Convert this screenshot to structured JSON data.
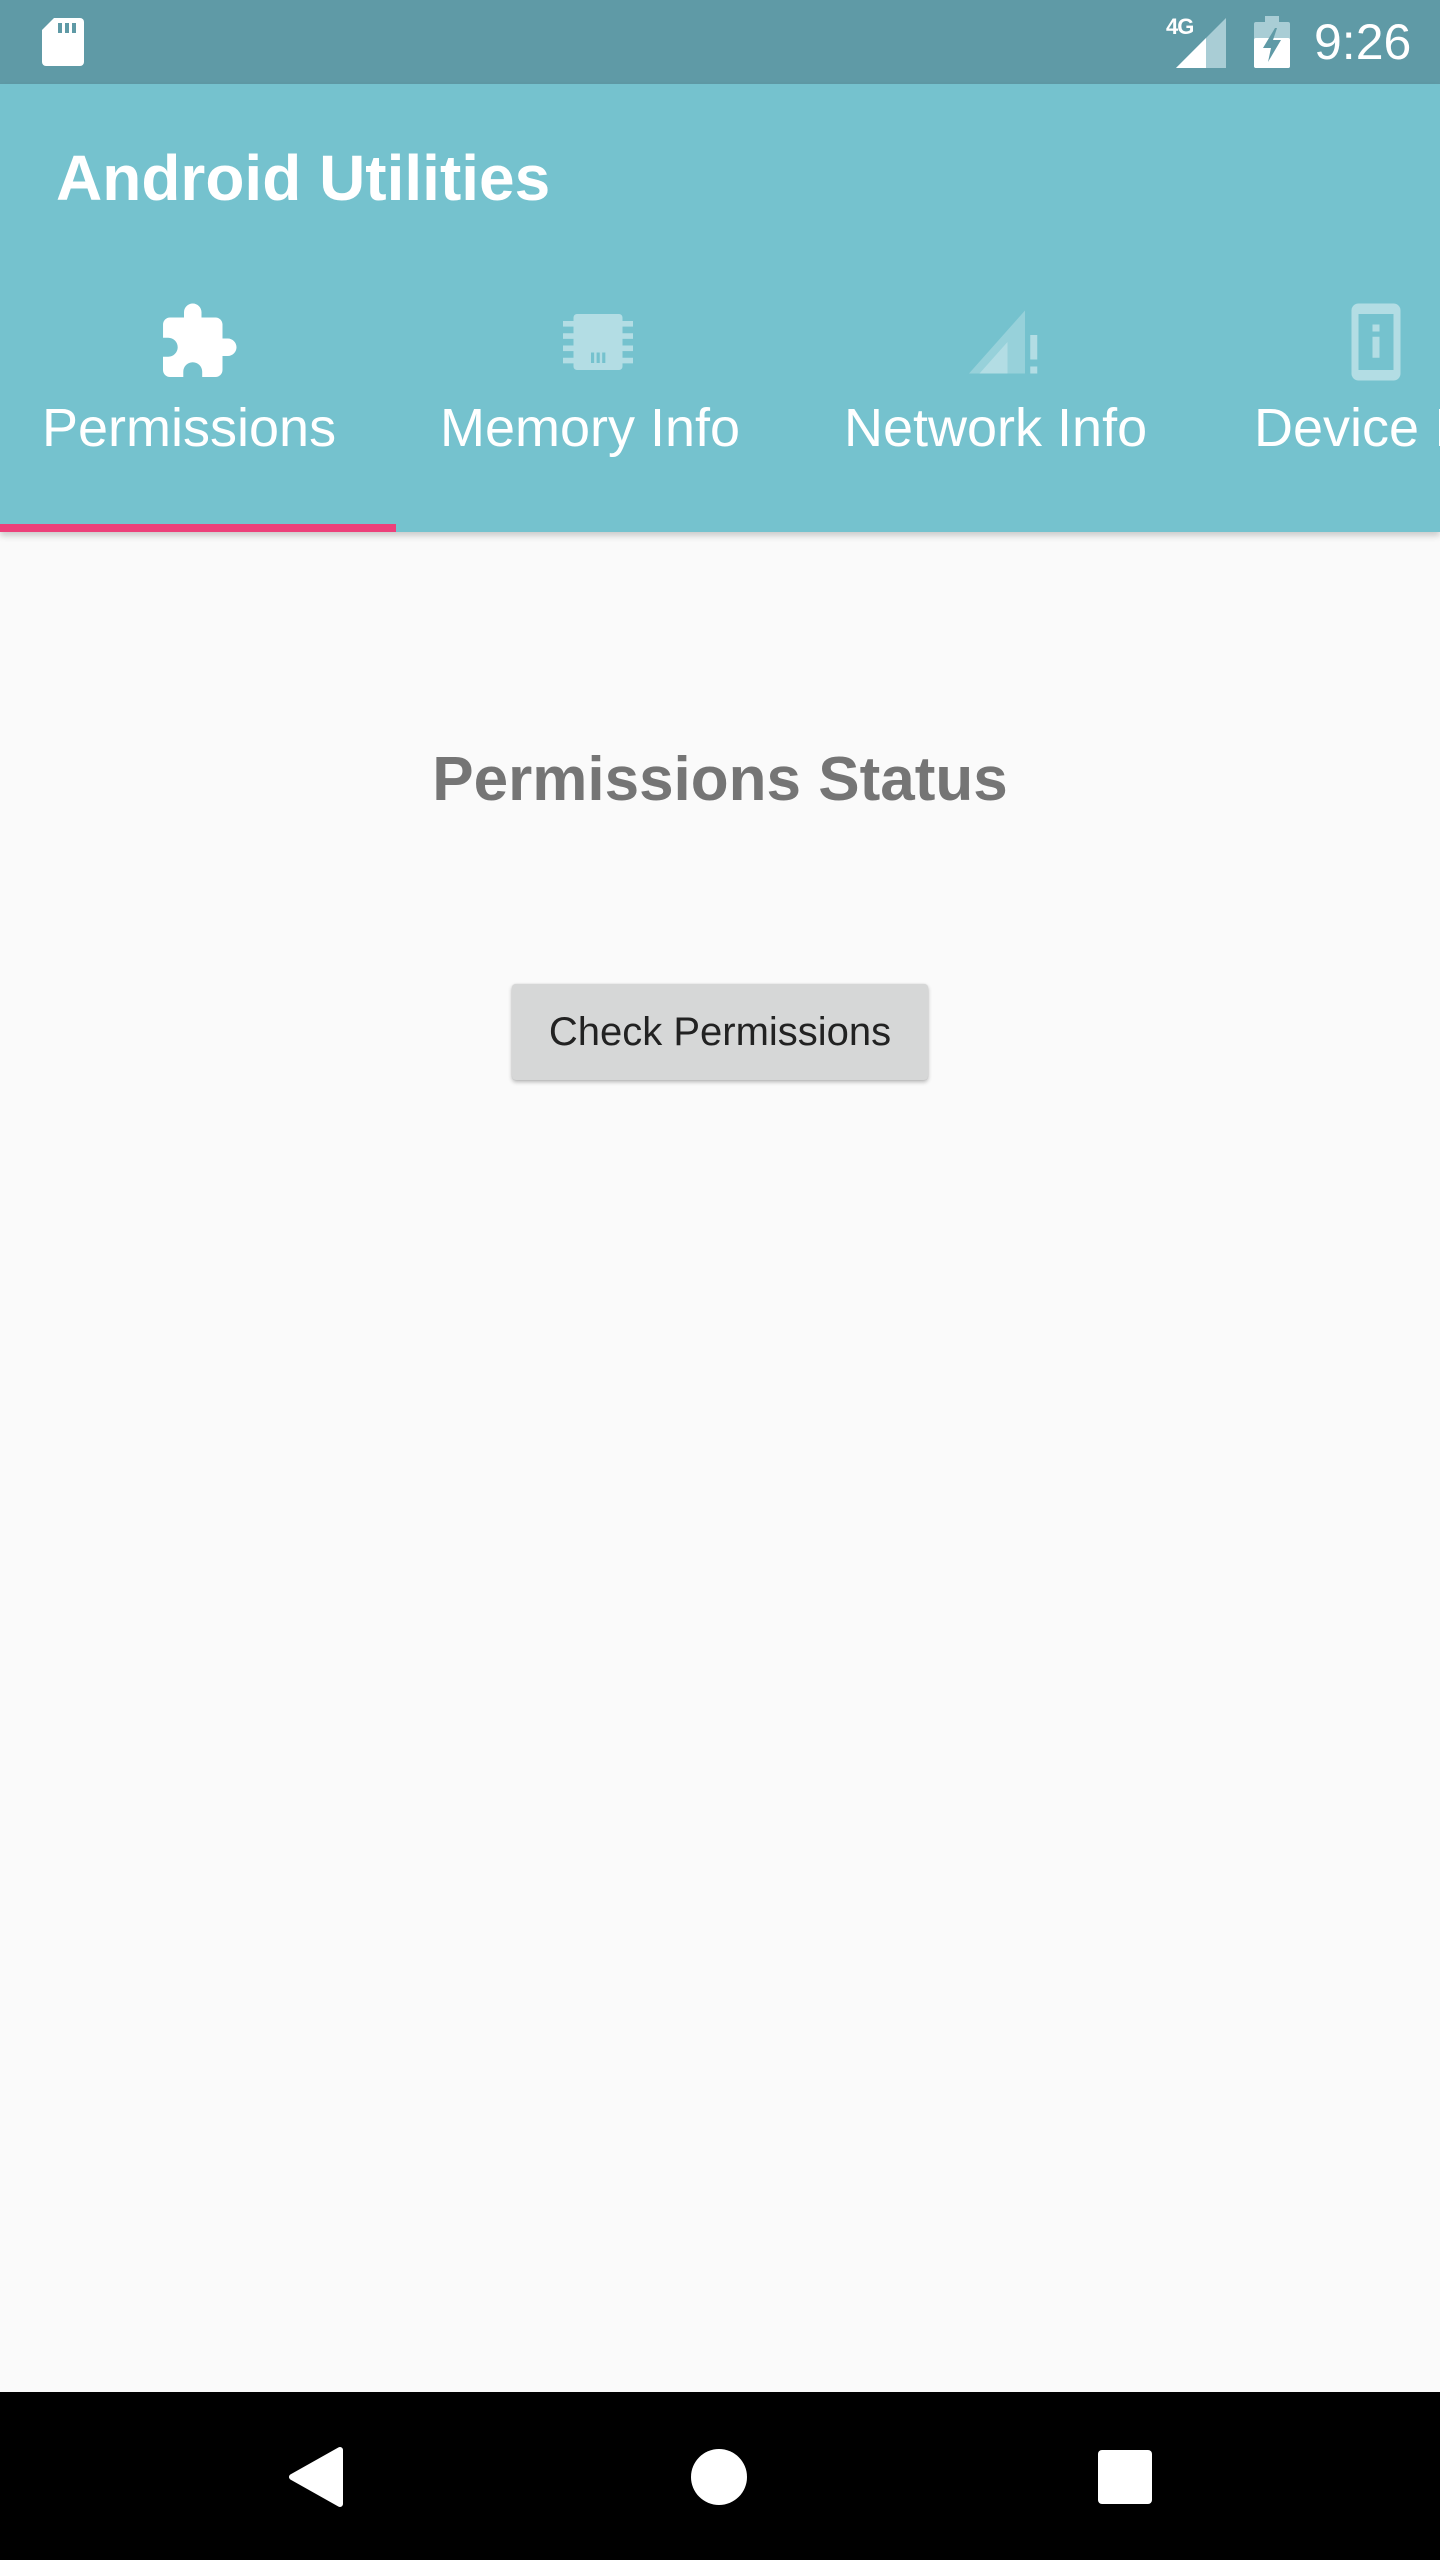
{
  "status_bar": {
    "network_type": "4G",
    "time": "9:26",
    "icons": [
      "sd-card-icon",
      "signal-icon",
      "battery-charging-icon"
    ]
  },
  "app_bar": {
    "title": "Android Utilities"
  },
  "tabs": [
    {
      "label": "Permissions",
      "icon": "puzzle-piece-icon",
      "selected": true
    },
    {
      "label": "Memory Info",
      "icon": "memory-chip-icon",
      "selected": false
    },
    {
      "label": "Network Info",
      "icon": "signal-alert-icon",
      "selected": false
    },
    {
      "label": "Device I",
      "icon": "device-info-icon",
      "selected": false
    }
  ],
  "content": {
    "title": "Permissions Status",
    "check_button_label": "Check Permissions"
  },
  "nav_bar": {
    "icons": [
      "back-icon",
      "home-icon",
      "recents-icon"
    ]
  },
  "colors": {
    "status_bar": "#5f9aa6",
    "app_bar": "#75c2ce",
    "tab_indicator": "#ec407a",
    "background": "#fafafa",
    "button": "#d6d7d7",
    "title_text": "#757575"
  }
}
